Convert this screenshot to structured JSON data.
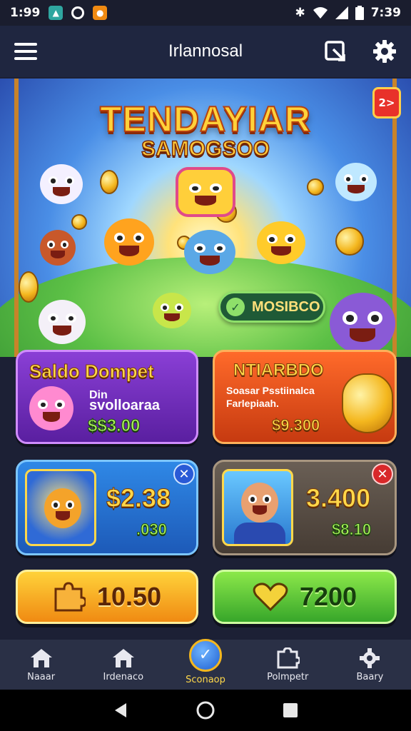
{
  "status_bar": {
    "time_left": "1:99",
    "time_right": "7:39"
  },
  "app_bar": {
    "title": "Irlannosal"
  },
  "hero": {
    "title": "TENDAYIAR",
    "subtitle": "SAMOGSOO",
    "badge": "2>",
    "pill_label": "MOSIBCO"
  },
  "cards": {
    "promo_left": {
      "title": "Saldo Dompet",
      "line1": "Din",
      "line2": "svolloaraa",
      "amount": "$$3.00"
    },
    "promo_right": {
      "title": "NTIARBDO",
      "line1": "Soasar Psstiinalca",
      "line2": "Farlepiaah.",
      "amount": "$9.300"
    },
    "stat_left": {
      "amount": "$2.38",
      "sub": ".030"
    },
    "stat_right": {
      "amount": "3.400",
      "sub": "$8.10"
    }
  },
  "buttons": {
    "left_value": "10.50",
    "right_value": "7200"
  },
  "bottom_nav": [
    {
      "label": "Naaar"
    },
    {
      "label": "Irdenaco"
    },
    {
      "label": "Sconaop"
    },
    {
      "label": "Polmpetr"
    },
    {
      "label": "Baary"
    }
  ],
  "colors": {
    "accent_gold": "#ffd84a",
    "accent_green": "#aaf25a",
    "purple_card": "#8a3fd6",
    "orange_card": "#ff6a2a"
  }
}
